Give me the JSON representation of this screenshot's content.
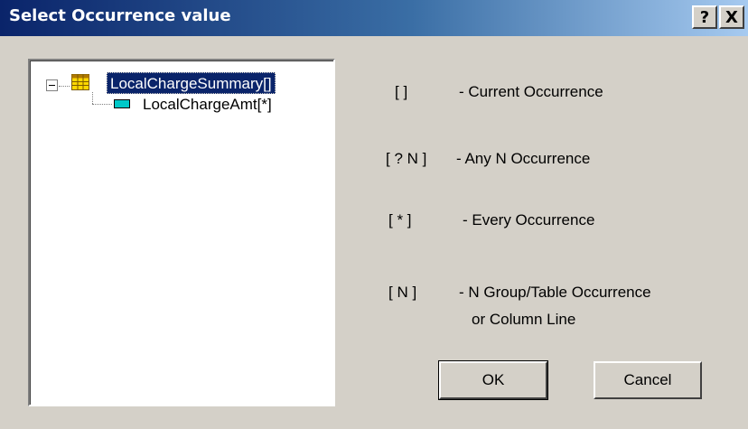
{
  "window": {
    "title": "Select Occurrence value",
    "help_label": "?",
    "close_label": "X"
  },
  "tree": {
    "root": {
      "label": "LocalChargeSummary[]",
      "icon": "table-icon",
      "expanded": true,
      "selected": true
    },
    "children": [
      {
        "label": "LocalChargeAmt[*]",
        "icon": "field-icon"
      }
    ]
  },
  "legend": [
    {
      "symbol": "[ ]",
      "description": "- Current Occurrence"
    },
    {
      "symbol": "[ ? N ]",
      "description": "- Any N Occurrence"
    },
    {
      "symbol": "[ * ]",
      "description": "- Every Occurrence"
    },
    {
      "symbol": "[ N ]",
      "description": "- N  Group/Table Occurrence",
      "description_line2": "or Column Line"
    }
  ],
  "buttons": {
    "ok_label": "OK",
    "cancel_label": "Cancel"
  },
  "colors": {
    "titlebar_start": "#0a246a",
    "titlebar_end": "#a6caf0",
    "selection": "#0a246a",
    "dialog_bg": "#d4d0c8"
  }
}
